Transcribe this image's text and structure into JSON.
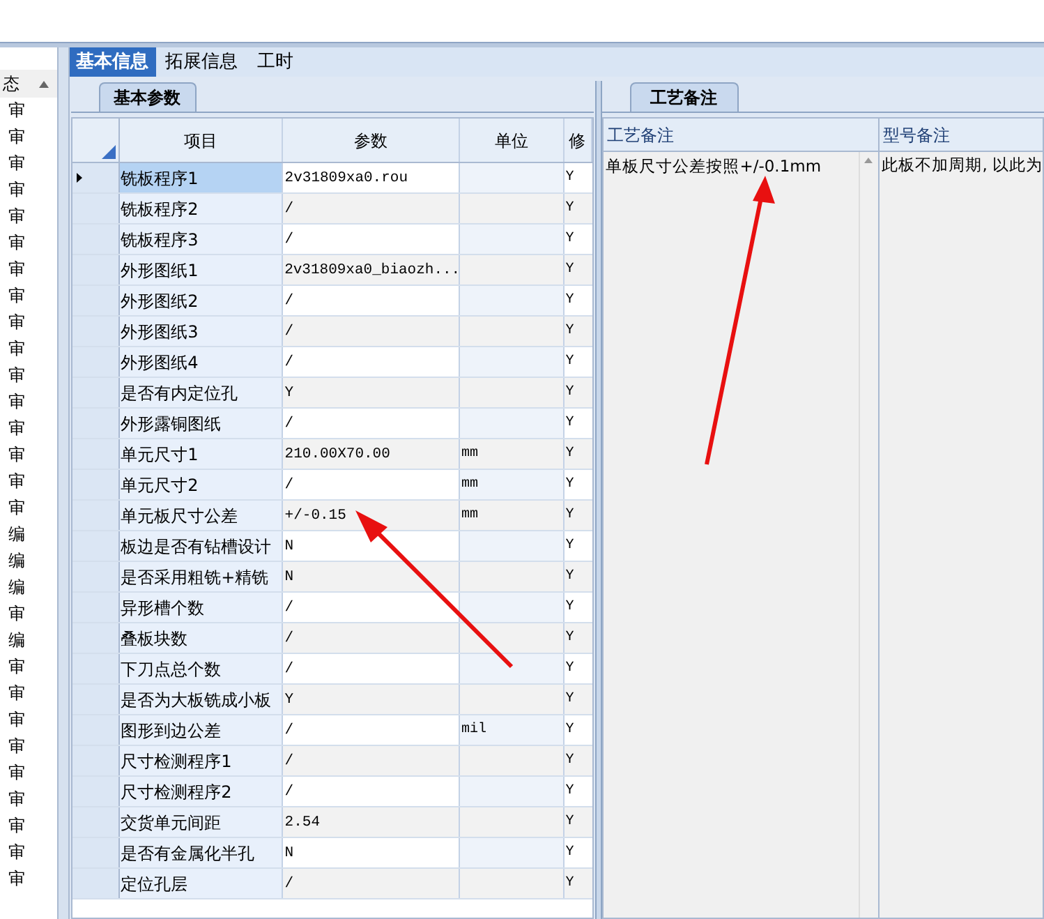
{
  "main_tabs": [
    {
      "label": "基本信息",
      "selected": true
    },
    {
      "label": "拓展信息",
      "selected": false
    },
    {
      "label": "工时",
      "selected": false
    }
  ],
  "side_list": {
    "header": "态",
    "items": [
      {
        "text": "审"
      },
      {
        "text": "审"
      },
      {
        "text": "审"
      },
      {
        "text": "审"
      },
      {
        "text": "审"
      },
      {
        "text": "审"
      },
      {
        "text": "审"
      },
      {
        "text": "审"
      },
      {
        "text": "审"
      },
      {
        "text": "审"
      },
      {
        "text": "审"
      },
      {
        "text": "审"
      },
      {
        "text": "审"
      },
      {
        "text": "审"
      },
      {
        "text": "审"
      },
      {
        "text": "审"
      },
      {
        "text": "编"
      },
      {
        "text": "编"
      },
      {
        "text": "编"
      },
      {
        "text": "审"
      },
      {
        "text": "编"
      },
      {
        "text": "审"
      },
      {
        "text": "审"
      },
      {
        "text": "审"
      },
      {
        "text": "审"
      },
      {
        "text": "审"
      },
      {
        "text": "审"
      },
      {
        "text": "审"
      },
      {
        "text": "审"
      },
      {
        "text": "审"
      }
    ]
  },
  "param_panel": {
    "tab": "基本参数",
    "columns": [
      "项目",
      "参数",
      "单位",
      "修"
    ],
    "rows": [
      {
        "item": "铣板程序1",
        "value": "2v31809xa0.rou",
        "unit": "",
        "flag": "Y",
        "selected": true
      },
      {
        "item": "铣板程序2",
        "value": "/",
        "unit": "",
        "flag": "Y",
        "selected": false
      },
      {
        "item": "铣板程序3",
        "value": "/",
        "unit": "",
        "flag": "Y",
        "selected": false
      },
      {
        "item": "外形图纸1",
        "value": "2v31809xa0_biaozh...",
        "unit": "",
        "flag": "Y",
        "selected": false
      },
      {
        "item": "外形图纸2",
        "value": "/",
        "unit": "",
        "flag": "Y",
        "selected": false
      },
      {
        "item": "外形图纸3",
        "value": "/",
        "unit": "",
        "flag": "Y",
        "selected": false
      },
      {
        "item": "外形图纸4",
        "value": "/",
        "unit": "",
        "flag": "Y",
        "selected": false
      },
      {
        "item": "是否有内定位孔",
        "value": "Y",
        "unit": "",
        "flag": "Y",
        "selected": false
      },
      {
        "item": "外形露铜图纸",
        "value": "/",
        "unit": "",
        "flag": "Y",
        "selected": false
      },
      {
        "item": "单元尺寸1",
        "value": "210.00X70.00",
        "unit": "mm",
        "flag": "Y",
        "selected": false
      },
      {
        "item": "单元尺寸2",
        "value": "/",
        "unit": "mm",
        "flag": "Y",
        "selected": false
      },
      {
        "item": "单元板尺寸公差",
        "value": "+/-0.15",
        "unit": "mm",
        "flag": "Y",
        "selected": false
      },
      {
        "item": "板边是否有钻槽设计",
        "value": "N",
        "unit": "",
        "flag": "Y",
        "selected": false
      },
      {
        "item": "是否采用粗铣+精铣",
        "value": "N",
        "unit": "",
        "flag": "Y",
        "selected": false
      },
      {
        "item": "异形槽个数",
        "value": "/",
        "unit": "",
        "flag": "Y",
        "selected": false
      },
      {
        "item": "叠板块数",
        "value": "/",
        "unit": "",
        "flag": "Y",
        "selected": false
      },
      {
        "item": "下刀点总个数",
        "value": "/",
        "unit": "",
        "flag": "Y",
        "selected": false
      },
      {
        "item": "是否为大板铣成小板",
        "value": "Y",
        "unit": "",
        "flag": "Y",
        "selected": false
      },
      {
        "item": "图形到边公差",
        "value": "/",
        "unit": "mil",
        "flag": "Y",
        "selected": false
      },
      {
        "item": "尺寸检测程序1",
        "value": "/",
        "unit": "",
        "flag": "Y",
        "selected": false
      },
      {
        "item": "尺寸检测程序2",
        "value": "/",
        "unit": "",
        "flag": "Y",
        "selected": false
      },
      {
        "item": "交货单元间距",
        "value": "2.54",
        "unit": "",
        "flag": "Y",
        "selected": false
      },
      {
        "item": "是否有金属化半孔",
        "value": "N",
        "unit": "",
        "flag": "Y",
        "selected": false
      },
      {
        "item": "定位孔层",
        "value": "/",
        "unit": "",
        "flag": "Y",
        "selected": false
      }
    ]
  },
  "notes_panel": {
    "tab": "工艺备注",
    "columns": [
      "工艺备注",
      "型号备注"
    ],
    "cells": [
      "单板尺寸公差按照+/-0.1mm",
      "此板不加周期, 以此为"
    ]
  }
}
